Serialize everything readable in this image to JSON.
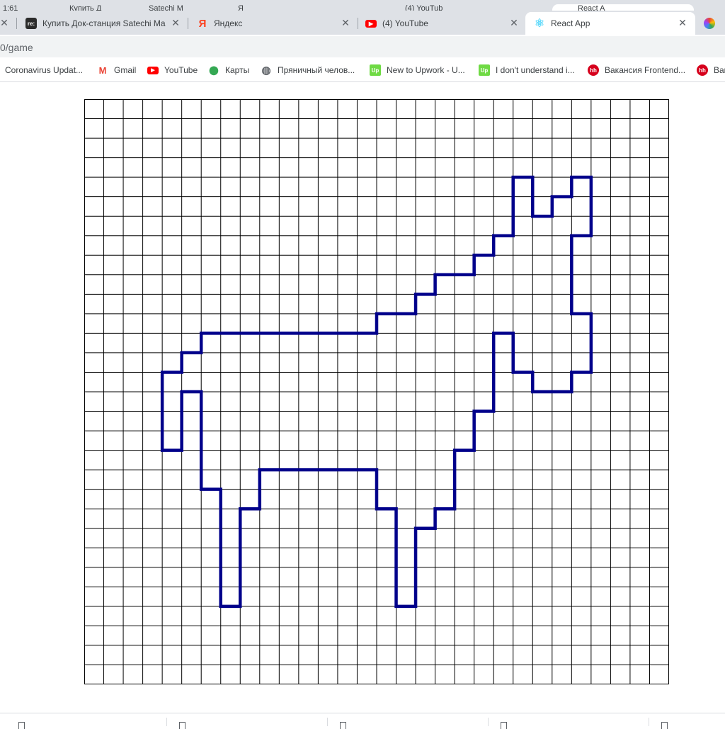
{
  "browser": {
    "hidden_tabs": [
      {
        "title": "1:61"
      },
      {
        "title": "Купить Д"
      },
      {
        "title": "Satechi M"
      },
      {
        "title": "Я"
      },
      {
        "title": "(4) YouTub"
      },
      {
        "title": "React A"
      }
    ],
    "tabs": [
      {
        "title": "Купить Док-станция Satechi Ma",
        "icon": "re-icon",
        "icon_text": "re:",
        "active": false
      },
      {
        "title": "Яндекс",
        "icon": "yandex-icon",
        "icon_text": "Я",
        "active": false
      },
      {
        "title": "(4) YouTube",
        "icon": "youtube-icon",
        "icon_text": "▶",
        "active": false
      },
      {
        "title": "React App",
        "icon": "react-icon",
        "icon_text": "⚛",
        "active": true
      }
    ],
    "close_glyph": "✕",
    "address": "0/game",
    "bookmarks": [
      {
        "label": "Coronavirus Updat...",
        "icon": "none"
      },
      {
        "label": "Gmail",
        "icon": "gmail-icon",
        "icon_text": "M"
      },
      {
        "label": "YouTube",
        "icon": "youtube-icon",
        "icon_text": "▶"
      },
      {
        "label": "Карты",
        "icon": "maps-icon",
        "icon_text": "⬤"
      },
      {
        "label": "Пряничный челов...",
        "icon": "globe-icon",
        "icon_text": "◍"
      },
      {
        "label": "New to Upwork - U...",
        "icon": "upwork-icon",
        "icon_text": "Up"
      },
      {
        "label": "I don't understand i...",
        "icon": "upwork-icon",
        "icon_text": "Up"
      },
      {
        "label": "Вакансия Frontend...",
        "icon": "hh-icon",
        "icon_text": "hh"
      },
      {
        "label": "Вак",
        "icon": "hh-icon",
        "icon_text": "hh"
      }
    ]
  },
  "game": {
    "grid_rows": 30,
    "grid_cols": 30,
    "grid_line_color": "#000000",
    "figure_color": "#00008b",
    "figure_cells": [
      [
        4,
        22
      ],
      [
        4,
        25
      ],
      [
        5,
        22
      ],
      [
        5,
        24
      ],
      [
        5,
        25
      ],
      [
        6,
        22
      ],
      [
        6,
        23
      ],
      [
        6,
        24
      ],
      [
        6,
        25
      ],
      [
        7,
        21
      ],
      [
        7,
        22
      ],
      [
        7,
        23
      ],
      [
        7,
        24
      ],
      [
        8,
        20
      ],
      [
        8,
        21
      ],
      [
        8,
        22
      ],
      [
        8,
        23
      ],
      [
        8,
        24
      ],
      [
        9,
        18
      ],
      [
        9,
        19
      ],
      [
        9,
        20
      ],
      [
        9,
        21
      ],
      [
        9,
        22
      ],
      [
        9,
        23
      ],
      [
        9,
        24
      ],
      [
        10,
        17
      ],
      [
        10,
        18
      ],
      [
        10,
        19
      ],
      [
        10,
        20
      ],
      [
        10,
        21
      ],
      [
        10,
        22
      ],
      [
        10,
        23
      ],
      [
        10,
        24
      ],
      [
        11,
        15
      ],
      [
        11,
        16
      ],
      [
        11,
        17
      ],
      [
        11,
        18
      ],
      [
        11,
        19
      ],
      [
        11,
        20
      ],
      [
        11,
        21
      ],
      [
        11,
        22
      ],
      [
        11,
        23
      ],
      [
        11,
        24
      ],
      [
        11,
        25
      ],
      [
        12,
        6
      ],
      [
        12,
        7
      ],
      [
        12,
        8
      ],
      [
        12,
        9
      ],
      [
        12,
        10
      ],
      [
        12,
        11
      ],
      [
        12,
        12
      ],
      [
        12,
        13
      ],
      [
        12,
        14
      ],
      [
        12,
        15
      ],
      [
        12,
        16
      ],
      [
        12,
        17
      ],
      [
        12,
        18
      ],
      [
        12,
        19
      ],
      [
        12,
        20
      ],
      [
        12,
        22
      ],
      [
        12,
        23
      ],
      [
        12,
        24
      ],
      [
        12,
        25
      ],
      [
        13,
        5
      ],
      [
        13,
        6
      ],
      [
        13,
        7
      ],
      [
        13,
        8
      ],
      [
        13,
        9
      ],
      [
        13,
        10
      ],
      [
        13,
        11
      ],
      [
        13,
        12
      ],
      [
        13,
        13
      ],
      [
        13,
        14
      ],
      [
        13,
        15
      ],
      [
        13,
        16
      ],
      [
        13,
        17
      ],
      [
        13,
        18
      ],
      [
        13,
        19
      ],
      [
        13,
        20
      ],
      [
        13,
        22
      ],
      [
        13,
        23
      ],
      [
        13,
        24
      ],
      [
        13,
        25
      ],
      [
        14,
        4
      ],
      [
        14,
        5
      ],
      [
        14,
        6
      ],
      [
        14,
        7
      ],
      [
        14,
        8
      ],
      [
        14,
        9
      ],
      [
        14,
        10
      ],
      [
        14,
        11
      ],
      [
        14,
        12
      ],
      [
        14,
        13
      ],
      [
        14,
        14
      ],
      [
        14,
        15
      ],
      [
        14,
        16
      ],
      [
        14,
        17
      ],
      [
        14,
        18
      ],
      [
        14,
        19
      ],
      [
        14,
        20
      ],
      [
        14,
        23
      ],
      [
        14,
        24
      ],
      [
        15,
        4
      ],
      [
        15,
        6
      ],
      [
        15,
        7
      ],
      [
        15,
        8
      ],
      [
        15,
        9
      ],
      [
        15,
        10
      ],
      [
        15,
        11
      ],
      [
        15,
        12
      ],
      [
        15,
        13
      ],
      [
        15,
        14
      ],
      [
        15,
        15
      ],
      [
        15,
        16
      ],
      [
        15,
        17
      ],
      [
        15,
        18
      ],
      [
        15,
        19
      ],
      [
        15,
        20
      ],
      [
        16,
        4
      ],
      [
        16,
        6
      ],
      [
        16,
        7
      ],
      [
        16,
        8
      ],
      [
        16,
        9
      ],
      [
        16,
        10
      ],
      [
        16,
        11
      ],
      [
        16,
        12
      ],
      [
        16,
        13
      ],
      [
        16,
        14
      ],
      [
        16,
        15
      ],
      [
        16,
        16
      ],
      [
        16,
        17
      ],
      [
        16,
        18
      ],
      [
        16,
        19
      ],
      [
        17,
        4
      ],
      [
        17,
        6
      ],
      [
        17,
        7
      ],
      [
        17,
        8
      ],
      [
        17,
        9
      ],
      [
        17,
        10
      ],
      [
        17,
        11
      ],
      [
        17,
        12
      ],
      [
        17,
        13
      ],
      [
        17,
        14
      ],
      [
        17,
        15
      ],
      [
        17,
        16
      ],
      [
        17,
        17
      ],
      [
        17,
        18
      ],
      [
        17,
        19
      ],
      [
        18,
        6
      ],
      [
        18,
        7
      ],
      [
        18,
        8
      ],
      [
        18,
        9
      ],
      [
        18,
        10
      ],
      [
        18,
        11
      ],
      [
        18,
        12
      ],
      [
        18,
        13
      ],
      [
        18,
        14
      ],
      [
        18,
        15
      ],
      [
        18,
        16
      ],
      [
        18,
        17
      ],
      [
        18,
        18
      ],
      [
        19,
        6
      ],
      [
        19,
        7
      ],
      [
        19,
        8
      ],
      [
        19,
        15
      ],
      [
        19,
        16
      ],
      [
        19,
        17
      ],
      [
        19,
        18
      ],
      [
        20,
        7
      ],
      [
        20,
        8
      ],
      [
        20,
        15
      ],
      [
        20,
        16
      ],
      [
        20,
        17
      ],
      [
        20,
        18
      ],
      [
        21,
        7
      ],
      [
        21,
        16
      ],
      [
        21,
        17
      ],
      [
        22,
        7
      ],
      [
        22,
        16
      ],
      [
        23,
        7
      ],
      [
        23,
        16
      ],
      [
        24,
        7
      ],
      [
        24,
        16
      ],
      [
        25,
        7
      ],
      [
        25,
        16
      ]
    ]
  }
}
